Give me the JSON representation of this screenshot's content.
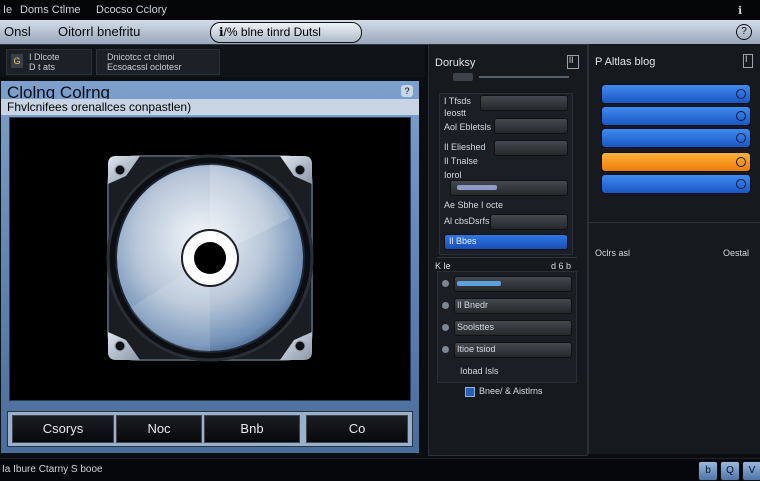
{
  "titlebar": {
    "left": "Ie",
    "items": [
      "Doms Ctlme",
      "Dcocso Cclory"
    ],
    "close": "ℹ"
  },
  "menubar": {
    "items": [
      "Onsl",
      "Oitorrl bnefritu"
    ],
    "pill": "ℹ/% blne tinrd Dutsl",
    "help": "?"
  },
  "toolbar": {
    "group1": {
      "icon": "G",
      "line1": "I Dlcote",
      "line2": "D t ats"
    },
    "group2": {
      "line1": "Dnicotcc ct clmoi",
      "line2": "Ecsoacssl oclotesr"
    }
  },
  "main": {
    "title": "Clolng Colrng",
    "close": "?",
    "subtitle": "Fhvlcnifees orenallces conpastlen)",
    "buttons": [
      "Csorys",
      "Noc",
      "Bnb",
      "Co"
    ],
    "accent": "#5b7fae"
  },
  "mid": {
    "title": "Doruksy",
    "icon": "lI",
    "rows": [
      {
        "label": "I Tfsds",
        "active": false
      },
      {
        "label": "Ieostt",
        "active": false
      },
      {
        "label": "Aol Ebletsls",
        "active": false
      },
      {
        "label": "Il Elieshed",
        "active": false
      },
      {
        "label": "Il Tnalse",
        "active": false
      },
      {
        "label": "Iorol",
        "active": false
      },
      {
        "label": "Ae Sbhe I octe",
        "active": false
      },
      {
        "label": "Al cbsDsrfs",
        "active": false
      },
      {
        "label": "Il Bbes",
        "active": true
      }
    ],
    "section2_left": "K le",
    "section2_right": "d 6 b",
    "rows2": [
      {
        "label": "",
        "active": false
      },
      {
        "label": "Il Bnedr",
        "active": false
      },
      {
        "label": "Soolsttes",
        "active": false
      },
      {
        "label": "Itioe tsiod",
        "active": false
      }
    ],
    "footer": "Iobad Isls",
    "checkbox_label": "Bnee/ & Aistlrns",
    "active_color": "#2f76e6"
  },
  "right": {
    "title": "P Altlas blog",
    "icon": "I",
    "bars": [
      {
        "color": "blue"
      },
      {
        "color": "blue"
      },
      {
        "color": "blue"
      },
      {
        "color": "orange"
      },
      {
        "color": "blue"
      }
    ],
    "footer_left": "Oclrs asl",
    "footer_right": "Oestal",
    "blue": "#2f76e6",
    "orange": "#ff9a1e"
  },
  "status": {
    "text": "Ia Ibure Ctarny S booe",
    "buttons": [
      "b",
      "Q",
      "V"
    ]
  }
}
